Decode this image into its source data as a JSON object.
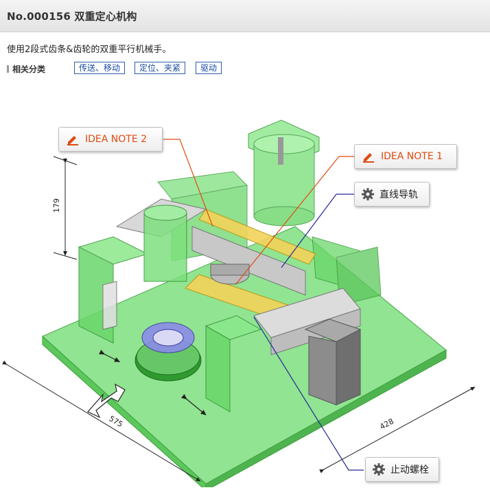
{
  "header": {
    "title": "No.000156 双重定心机构"
  },
  "description": "使用2段式齿条&齿轮的双重平行机械手。",
  "categories": {
    "label": "相关分类",
    "tags": [
      "传送、移动",
      "定位、夹紧",
      "驱动"
    ]
  },
  "callouts": {
    "idea_note_2": "IDEA NOTE 2",
    "idea_note_1": "IDEA NOTE 1",
    "linear_guide": "直线导轨",
    "stop_bolt": "止动螺栓"
  },
  "dimensions": {
    "height": "179",
    "length": "575",
    "width": "428"
  },
  "colors": {
    "accent_orange": "#e04a10",
    "tag_blue": "#2b5ea9",
    "frame_green": "#5fd35f"
  }
}
